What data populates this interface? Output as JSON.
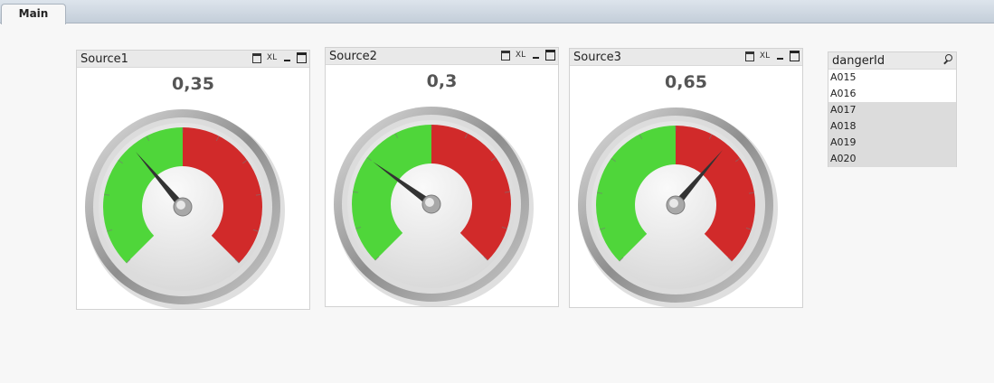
{
  "tabs": [
    {
      "label": "Main",
      "active": true
    }
  ],
  "gauges": [
    {
      "title": "Source1",
      "value_text": "0,35",
      "value": 0.35,
      "min": 0,
      "max": 1,
      "threshold": 0.5
    },
    {
      "title": "Source2",
      "value_text": "0,3",
      "value": 0.3,
      "min": 0,
      "max": 1,
      "threshold": 0.5
    },
    {
      "title": "Source3",
      "value_text": "0,65",
      "value": 0.65,
      "min": 0,
      "max": 1,
      "threshold": 0.5
    }
  ],
  "caption_icons": {
    "print": "print-icon",
    "xl": "XL",
    "minimize": "minimize-icon",
    "maximize": "maximize-icon"
  },
  "colors": {
    "green": "#4fd63a",
    "red": "#d12a2a",
    "needle": "#333333",
    "excluded": "#dcdcdc"
  },
  "listbox": {
    "title": "dangerId",
    "items": [
      {
        "label": "A015",
        "state": "optional"
      },
      {
        "label": "A016",
        "state": "optional"
      },
      {
        "label": "A017",
        "state": "excluded"
      },
      {
        "label": "A018",
        "state": "excluded"
      },
      {
        "label": "A019",
        "state": "excluded"
      },
      {
        "label": "A020",
        "state": "excluded"
      }
    ]
  }
}
